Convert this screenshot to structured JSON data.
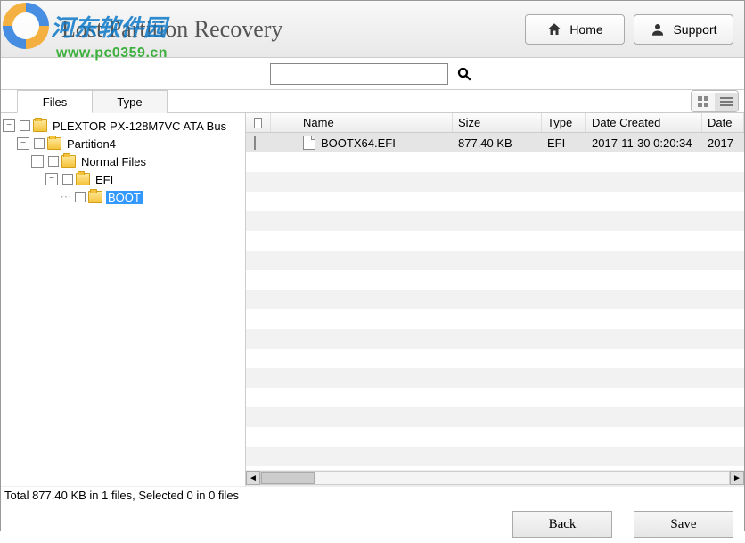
{
  "header": {
    "title": "Lost Partition Recovery",
    "home_label": "Home",
    "support_label": "Support"
  },
  "watermark": {
    "brand_text": "河东软件园",
    "url": "www.pc0359.cn"
  },
  "search": {
    "value": "",
    "placeholder": ""
  },
  "tabs": {
    "files": "Files",
    "type": "Type",
    "active": "files"
  },
  "tree": {
    "root": {
      "label": "PLEXTOR PX-128M7VC  ATA Bus",
      "children": [
        {
          "label": "Partition4",
          "children": [
            {
              "label": "Normal Files",
              "children": [
                {
                  "label": "EFI",
                  "children": [
                    {
                      "label": "BOOT",
                      "selected": true
                    }
                  ]
                }
              ]
            }
          ]
        }
      ]
    }
  },
  "columns": {
    "name": "Name",
    "size": "Size",
    "type": "Type",
    "date_created": "Date Created",
    "date2": "Date"
  },
  "files": [
    {
      "name": "BOOTX64.EFI",
      "size": "877.40 KB",
      "type": "EFI",
      "date_created": "2017-11-30 0:20:34",
      "date2": "2017-"
    }
  ],
  "status": "Total 877.40 KB in 1 files,  Selected 0 in 0 files",
  "footer": {
    "back": "Back",
    "save": "Save"
  }
}
